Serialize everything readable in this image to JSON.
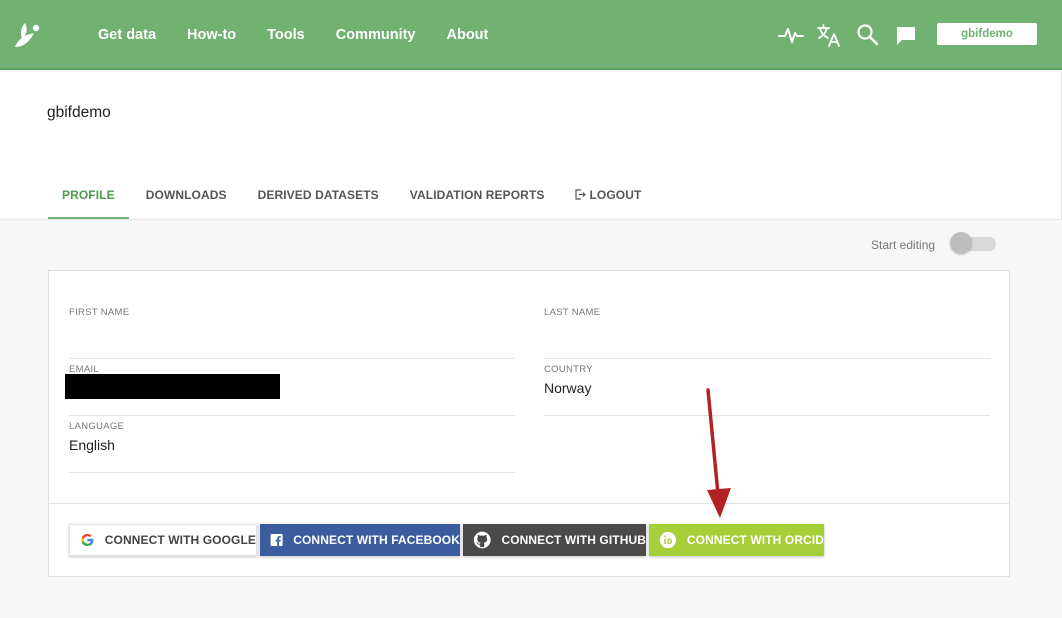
{
  "nav": {
    "items": [
      "Get data",
      "How-to",
      "Tools",
      "Community",
      "About"
    ],
    "icons": [
      "activity-icon",
      "translate-icon",
      "search-icon",
      "feedback-icon"
    ],
    "user_button": "gbifdemo"
  },
  "profile": {
    "username": "gbifdemo",
    "tabs": [
      "PROFILE",
      "DOWNLOADS",
      "DERIVED DATASETS",
      "VALIDATION REPORTS",
      "LOGOUT"
    ],
    "active_tab": "PROFILE",
    "start_editing_label": "Start editing",
    "fields": {
      "first_name": {
        "label": "FIRST NAME",
        "value": ""
      },
      "last_name": {
        "label": "LAST NAME",
        "value": ""
      },
      "email": {
        "label": "EMAIL",
        "value": ""
      },
      "country": {
        "label": "COUNTRY",
        "value": "Norway"
      },
      "language": {
        "label": "LANGUAGE",
        "value": "English"
      }
    },
    "connect": {
      "google": "CONNECT WITH GOOGLE",
      "facebook": "CONNECT WITH FACEBOOK",
      "github": "CONNECT WITH GITHUB",
      "orcid": "CONNECT WITH ORCID"
    }
  },
  "colors": {
    "brand_green": "#71b171",
    "facebook_blue": "#3b5da0",
    "github_gray": "#4a4a4a",
    "orcid_green": "#a6ce39",
    "annotation_red": "#b22222"
  }
}
